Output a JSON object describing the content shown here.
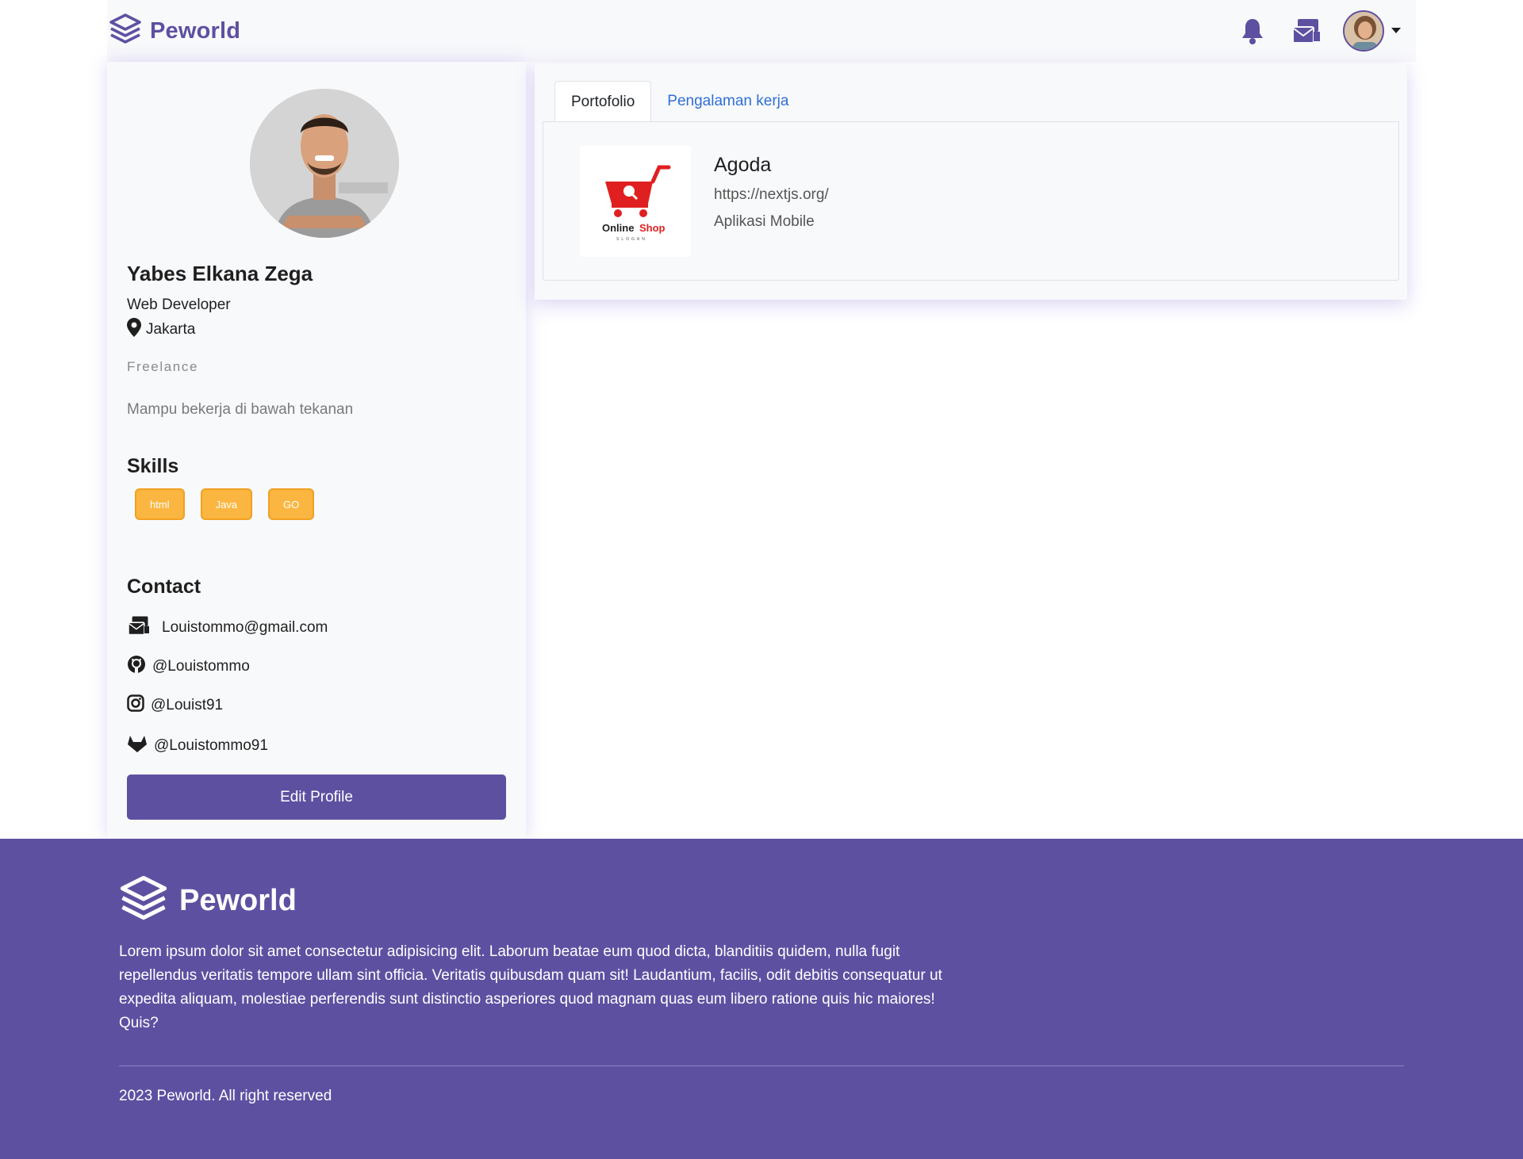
{
  "navbar": {
    "brand": "Peworld",
    "icons": {
      "notification": "bell-icon",
      "messages": "mail-icon",
      "dropdown": "caret-down-icon"
    }
  },
  "profile": {
    "name": "Yabes Elkana Zega",
    "job": "Web Developer",
    "location": "Jakarta",
    "type": "Freelance",
    "description": "Mampu bekerja di bawah tekanan",
    "skills_title": "Skills",
    "skills": [
      "html",
      "Java",
      "GO"
    ],
    "contact_title": "Contact",
    "contacts": {
      "email": "Louistommo@gmail.com",
      "github": "@Louistommo",
      "instagram": "@Louist91",
      "gitlab": "@Louistommo91"
    },
    "edit_button": "Edit Profile"
  },
  "tabs": {
    "portfolio": "Portofolio",
    "experience": "Pengalaman kerja"
  },
  "portfolio_item": {
    "logo_text_1": "Online",
    "logo_text_2": "Shop",
    "logo_slogan": "SLOGAN",
    "title": "Agoda",
    "url": "https://nextjs.org/",
    "type": "Aplikasi Mobile"
  },
  "footer": {
    "brand": "Peworld",
    "description": "Lorem ipsum dolor sit amet consectetur adipisicing elit. Laborum beatae eum quod dicta, blanditiis quidem, nulla fugit repellendus veritatis tempore ullam sint officia. Veritatis quibusdam quam sit! Laudantium, facilis, odit debitis consequatur ut expedita aliquam, molestiae perferendis sunt distinctio asperiores quod magnam quas eum libero ratione quis hic maiores! Quis?",
    "copyright": "2023 Peworld. All right reserved"
  },
  "colors": {
    "primary": "#5e50a1",
    "skill": "#fbb641",
    "link": "#2f6fd6"
  }
}
